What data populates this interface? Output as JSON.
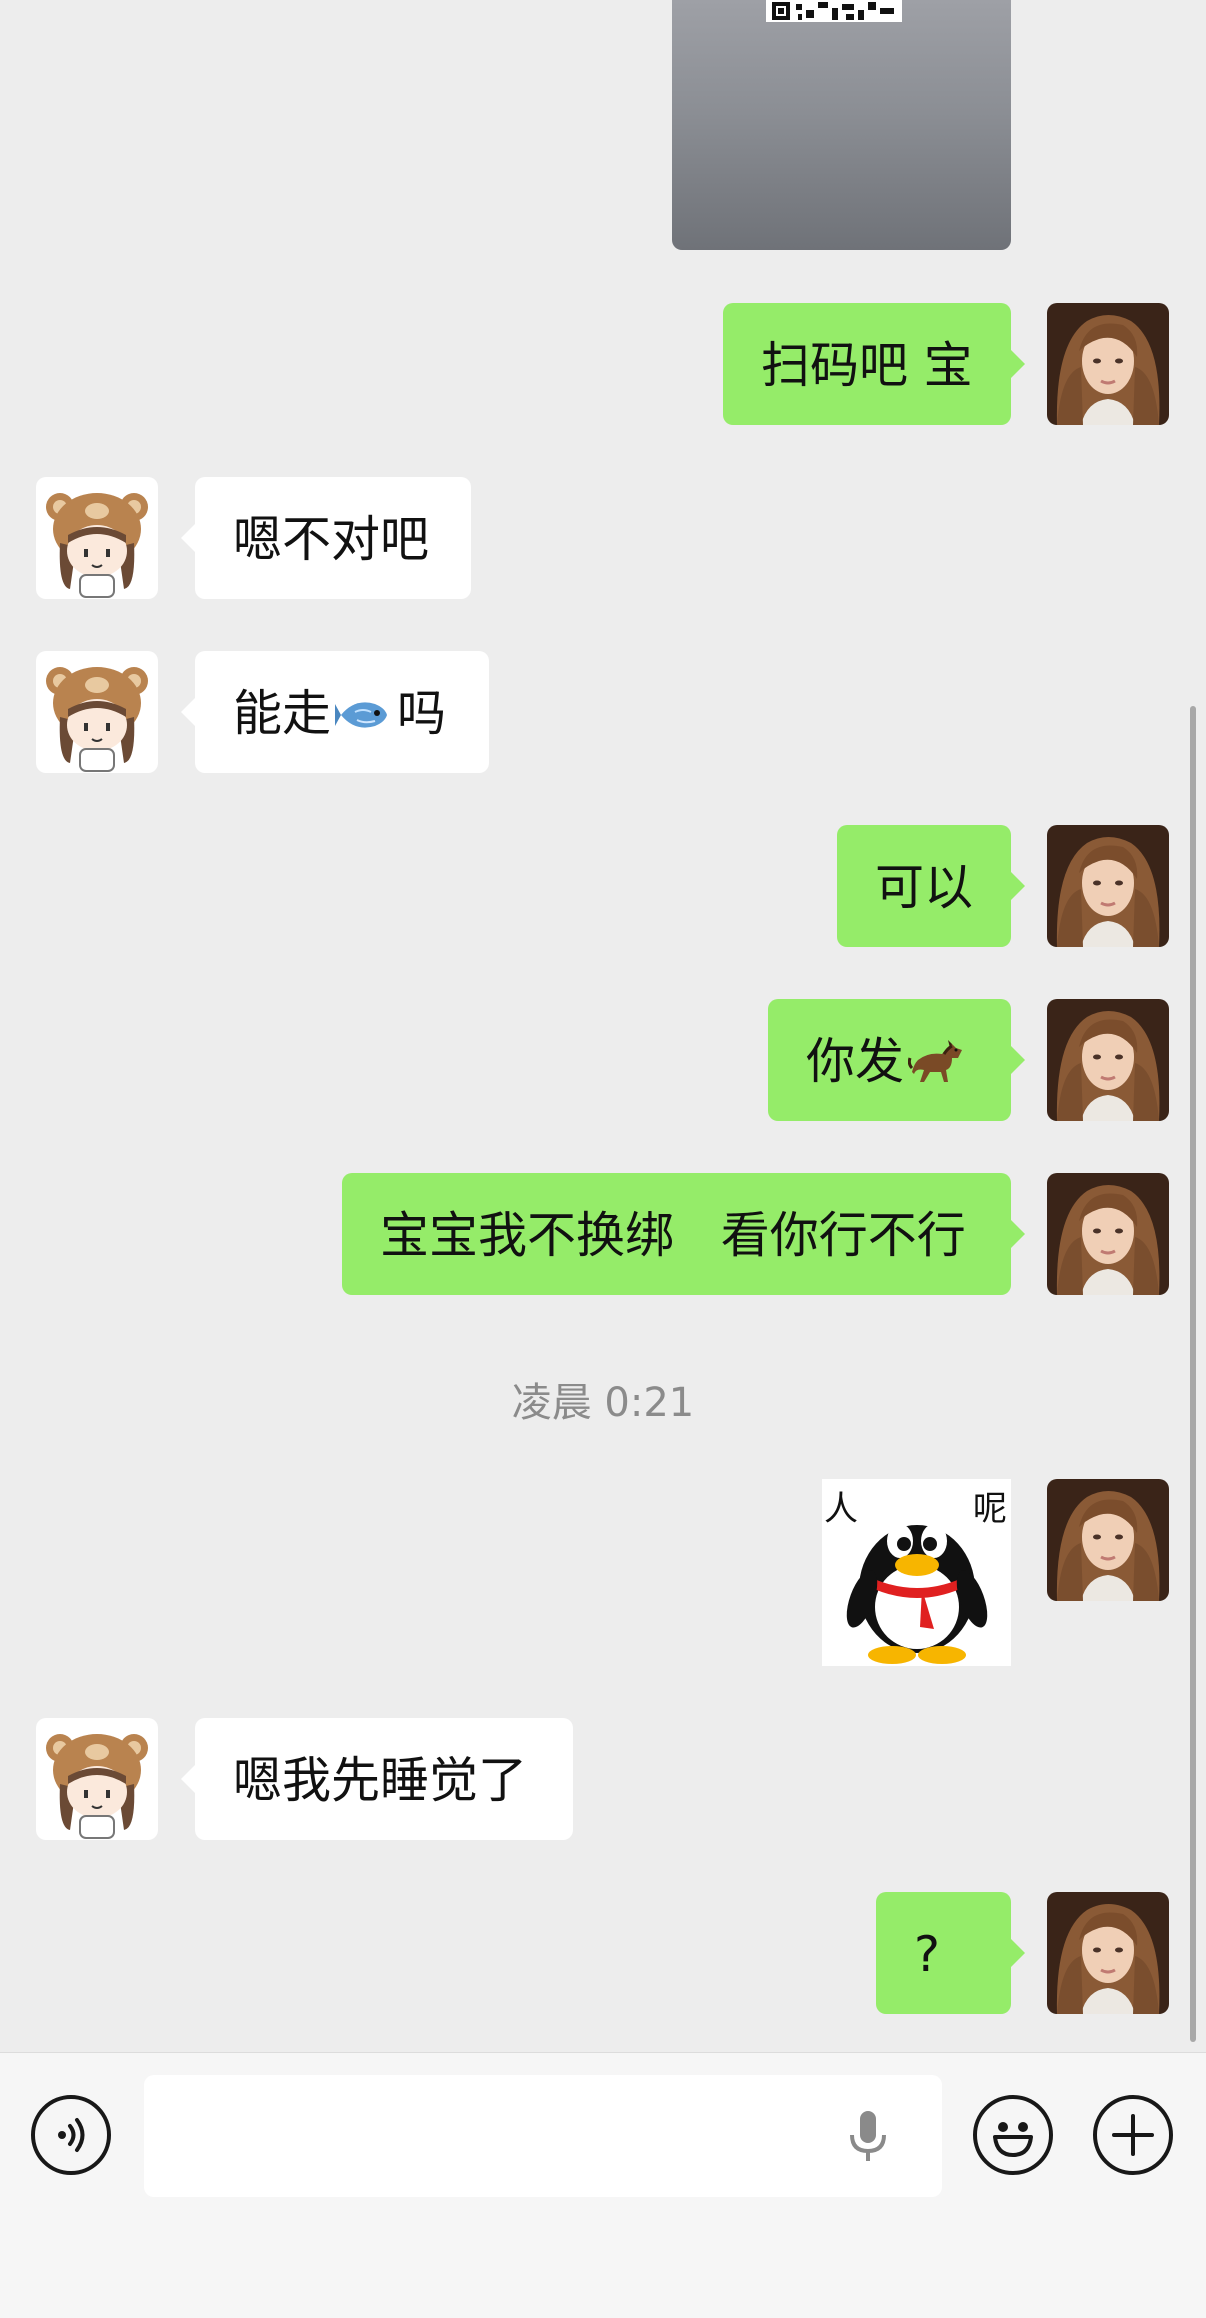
{
  "messages": {
    "m1": {
      "text": "扫码吧 宝"
    },
    "m2": {
      "text": "嗯不对吧"
    },
    "m3": {
      "before": "能走",
      "after": "吗",
      "emoji": "fish-emoji"
    },
    "m4": {
      "text": "可以"
    },
    "m5": {
      "before": "你发",
      "emoji": "horse-emoji"
    },
    "m6": {
      "text": "宝宝我不换绑   看你行不行"
    },
    "m7": {
      "sticker": "qq-penguin-sticker",
      "left_char": "人",
      "right_char": "呢"
    },
    "m8": {
      "text": "嗯我先睡觉了"
    },
    "m9": {
      "text": "?"
    }
  },
  "timestamp": "凌晨 0:21",
  "input": {
    "value": "",
    "icons": [
      "voice-icon",
      "microphone-icon",
      "emoji-icon",
      "plus-icon"
    ]
  },
  "colors": {
    "background": "#ededed",
    "sent_bubble": "#95ec69",
    "received_bubble": "#ffffff"
  }
}
